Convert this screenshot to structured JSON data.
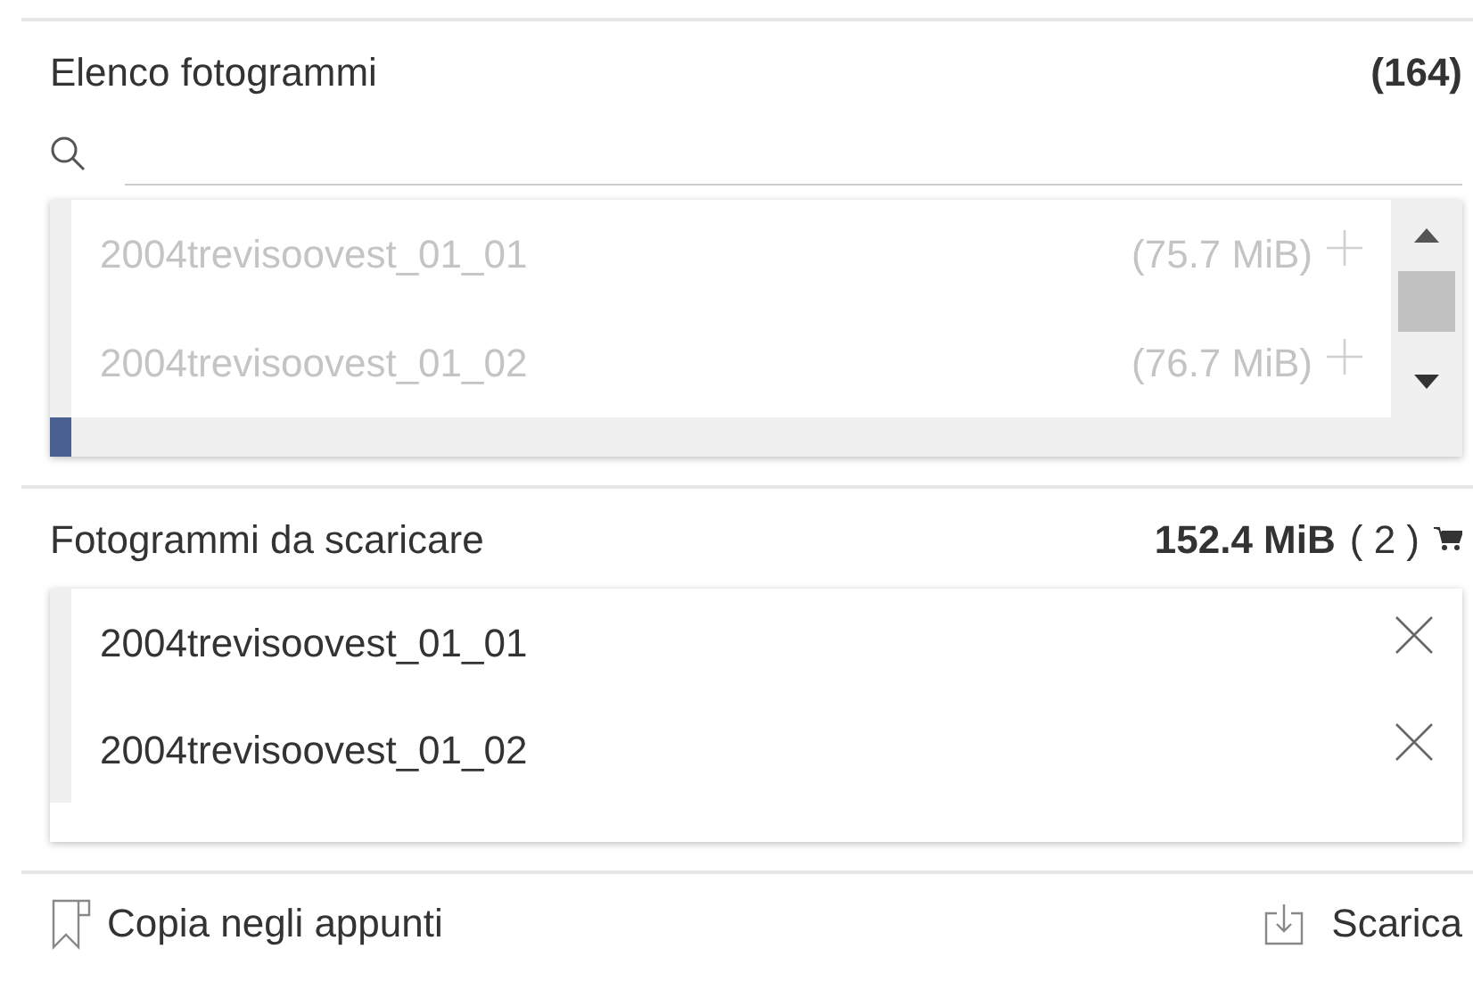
{
  "frames_panel": {
    "title": "Elenco fotogrammi",
    "count": "(164)",
    "rows": [
      {
        "name": "2004trevisoovest_01_01",
        "size": "(75.7 MiB)",
        "in_cart": true,
        "selected": false
      },
      {
        "name": "2004trevisoovest_01_02",
        "size": "(76.7 MiB)",
        "in_cart": true,
        "selected": false
      },
      {
        "selected": true
      }
    ]
  },
  "download_panel": {
    "title": "Fotogrammi da scaricare",
    "total": "152.4 MiB",
    "count": "( 2 )",
    "items": [
      {
        "name": "2004trevisoovest_01_01"
      },
      {
        "name": "2004trevisoovest_01_02"
      }
    ]
  },
  "footer": {
    "copy_label": "Copia negli appunti",
    "download_label": "Scarica"
  }
}
